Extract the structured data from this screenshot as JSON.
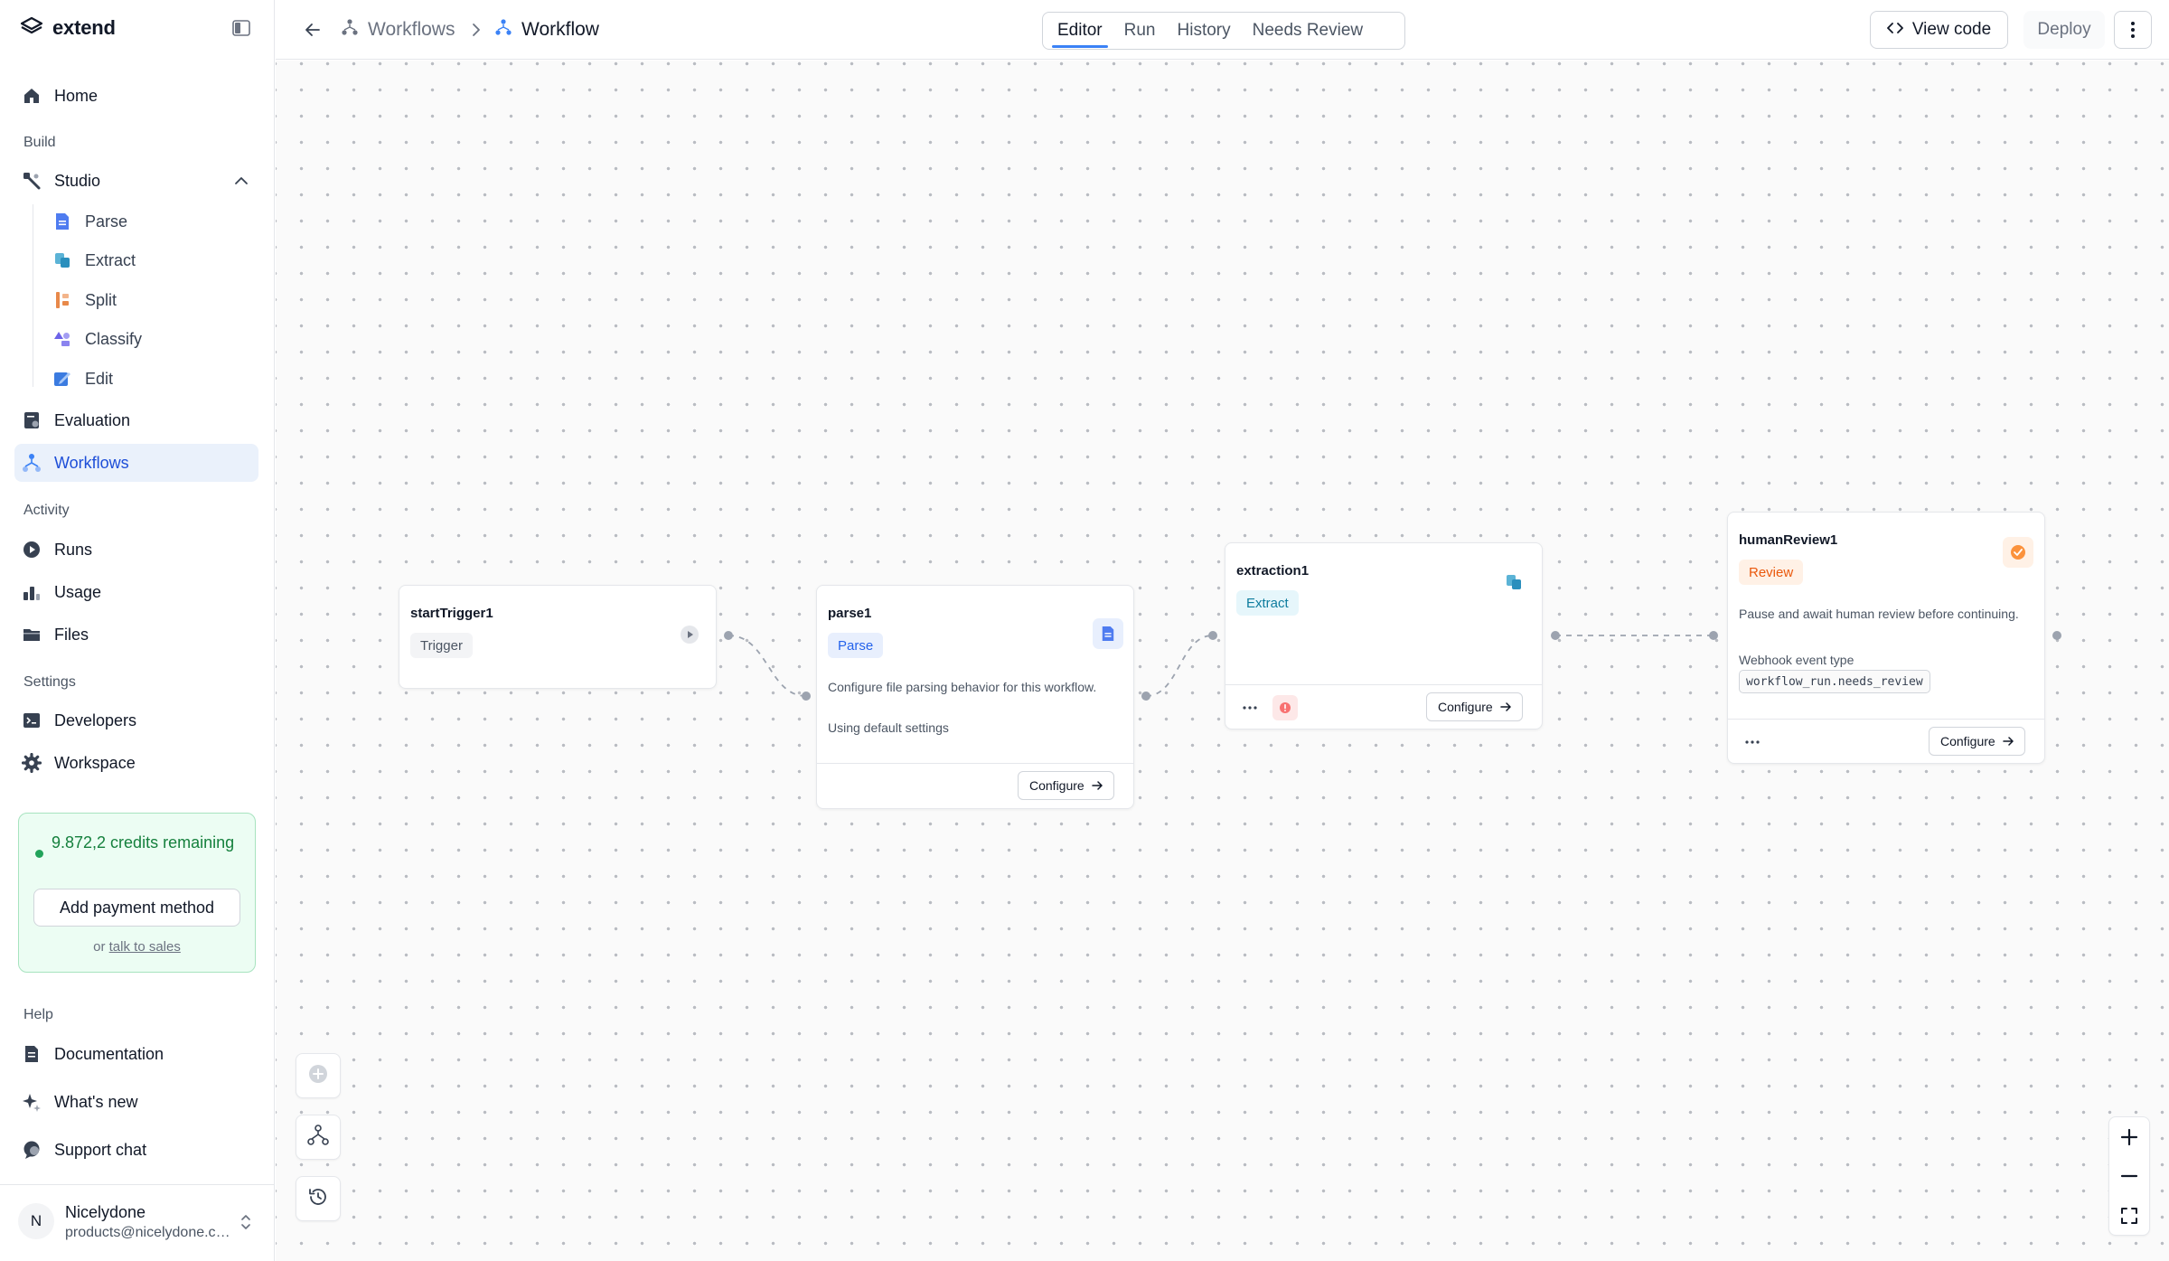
{
  "app": {
    "brand": "extend"
  },
  "sidebar": {
    "home": "Home",
    "section_build": "Build",
    "studio": "Studio",
    "studio_items": [
      "Parse",
      "Extract",
      "Split",
      "Classify",
      "Edit"
    ],
    "evaluation": "Evaluation",
    "workflows": "Workflows",
    "section_activity": "Activity",
    "runs": "Runs",
    "usage": "Usage",
    "files": "Files",
    "section_settings": "Settings",
    "developers": "Developers",
    "workspace": "Workspace",
    "credits": {
      "text": "9.872,2 credits remaining",
      "button": "Add payment method",
      "or_text": "or",
      "sales_link": "talk to sales"
    },
    "section_help": "Help",
    "documentation": "Documentation",
    "whats_new": "What's new",
    "support_chat": "Support chat",
    "user": {
      "initial": "N",
      "name": "Nicelydone",
      "email": "products@nicelydone.club"
    }
  },
  "topbar": {
    "crumb_parent": "Workflows",
    "crumb_current": "Workflow",
    "tabs": [
      "Editor",
      "Run",
      "History",
      "Needs Review"
    ],
    "active_tab": "Editor",
    "view_code": "View code",
    "deploy": "Deploy"
  },
  "nodes": {
    "start": {
      "title": "startTrigger1",
      "tag": "Trigger"
    },
    "parse": {
      "title": "parse1",
      "tag": "Parse",
      "description": "Configure file parsing behavior for this workflow.",
      "settings": "Using default settings",
      "configure": "Configure"
    },
    "extraction": {
      "title": "extraction1",
      "tag": "Extract",
      "configure": "Configure"
    },
    "review": {
      "title": "humanReview1",
      "tag": "Review",
      "description": "Pause and await human review before continuing.",
      "webhook_label": "Webhook event type",
      "webhook_value": "workflow_run.needs_review",
      "configure": "Configure"
    }
  },
  "colors": {
    "accent": "#3b82f6",
    "active_nav_bg": "#eaf1fb",
    "credits_bg": "#ecfdf3",
    "credits_text": "#15803d",
    "review_orange": "#ea580c",
    "extract_teal": "#0e7c9e",
    "parse_blue": "#2563eb"
  }
}
